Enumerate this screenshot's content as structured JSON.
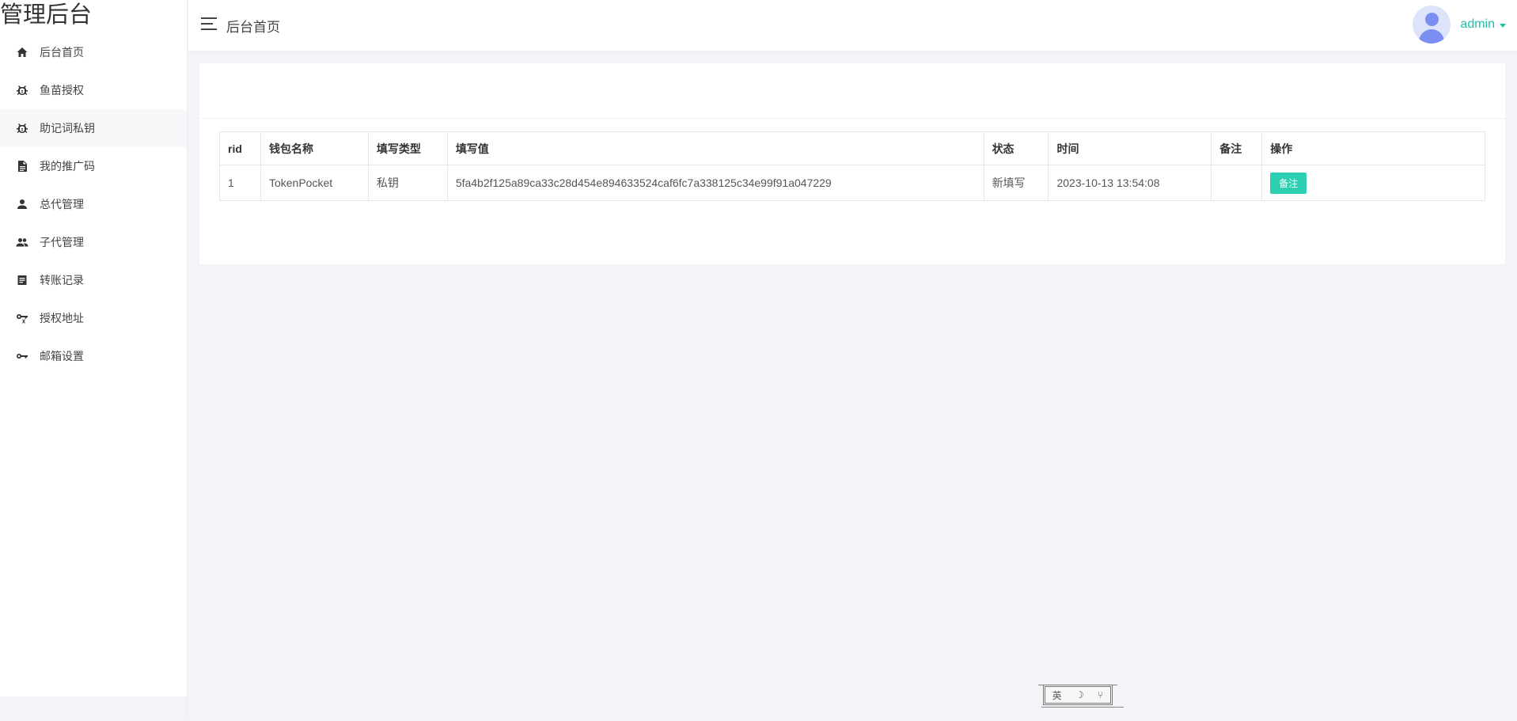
{
  "sidebar": {
    "logo": "管理后台",
    "items": [
      {
        "label": "后台首页",
        "icon": "home-icon"
      },
      {
        "label": "鱼苗授权",
        "icon": "bug-icon"
      },
      {
        "label": "助记词私钥",
        "icon": "bug-icon"
      },
      {
        "label": "我的推广码",
        "icon": "document-icon"
      },
      {
        "label": "总代管理",
        "icon": "person-icon"
      },
      {
        "label": "子代管理",
        "icon": "people-icon"
      },
      {
        "label": "转账记录",
        "icon": "receipt-icon"
      },
      {
        "label": "授权地址",
        "icon": "key-x-icon"
      },
      {
        "label": "邮箱设置",
        "icon": "key-icon"
      }
    ],
    "active_index": 2
  },
  "header": {
    "breadcrumb": "后台首页",
    "user": "admin"
  },
  "table": {
    "columns": [
      "rid",
      "钱包名称",
      "填写类型",
      "填写值",
      "状态",
      "时间",
      "备注",
      "操作"
    ],
    "rows": [
      {
        "rid": "1",
        "wallet": "TokenPocket",
        "type": "私钥",
        "value": "5fa4b2f125a89ca33c28d454e894633524caf6fc7a338125c34e99f91a047229",
        "status": "新填写",
        "time": "2023-10-13 13:54:08",
        "note": "",
        "action": "备注"
      }
    ]
  },
  "widget": {
    "glyphs": [
      "英",
      "☽",
      "⑂"
    ]
  },
  "colors": {
    "accent": "#2ccfb2",
    "user_link": "#1fbfa4",
    "avatar_fill": "#7d8ef2"
  }
}
